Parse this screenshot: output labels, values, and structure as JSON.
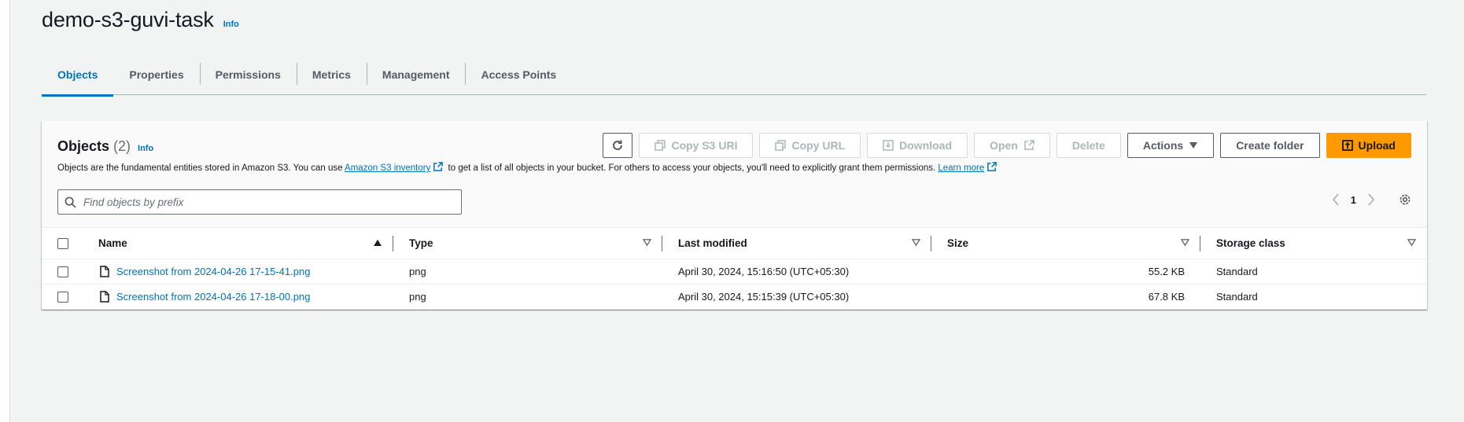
{
  "bucket": {
    "title": "demo-s3-guvi-task",
    "info": "Info"
  },
  "tabs": [
    {
      "label": "Objects",
      "active": true
    },
    {
      "label": "Properties"
    },
    {
      "label": "Permissions"
    },
    {
      "label": "Metrics"
    },
    {
      "label": "Management"
    },
    {
      "label": "Access Points"
    }
  ],
  "objects_panel": {
    "heading": "Objects",
    "count": "(2)",
    "info": "Info",
    "description_pre": "Objects are the fundamental entities stored in Amazon S3. You can use ",
    "inventory_link": "Amazon S3 inventory",
    "description_mid": " to get a list of all objects in your bucket. For others to access your objects, you'll need to explicitly grant them permissions. ",
    "learn_more": "Learn more",
    "search_placeholder": "Find objects by prefix",
    "page_number": "1",
    "toolbar": {
      "copy_s3_uri": "Copy S3 URI",
      "copy_url": "Copy URL",
      "download": "Download",
      "open": "Open",
      "delete": "Delete",
      "actions": "Actions",
      "create_folder": "Create folder",
      "upload": "Upload"
    }
  },
  "table": {
    "columns": [
      "Name",
      "Type",
      "Last modified",
      "Size",
      "Storage class"
    ],
    "rows": [
      {
        "name": "Screenshot from 2024-04-26 17-15-41.png",
        "type": "png",
        "last_modified": "April 30, 2024, 15:16:50 (UTC+05:30)",
        "size": "55.2 KB",
        "storage_class": "Standard"
      },
      {
        "name": "Screenshot from 2024-04-26 17-18-00.png",
        "type": "png",
        "last_modified": "April 30, 2024, 15:15:39 (UTC+05:30)",
        "size": "67.8 KB",
        "storage_class": "Standard"
      }
    ]
  },
  "colors": {
    "link": "#0073bb",
    "primary_button": "#ff9900",
    "page_background": "#f2f3f3"
  }
}
